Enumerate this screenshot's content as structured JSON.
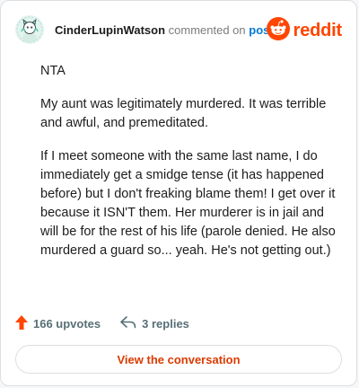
{
  "header": {
    "author": "CinderLupinWatson",
    "meta_text": "commented on",
    "post_link": "post",
    "brand": "reddit"
  },
  "comment": {
    "paragraphs": [
      "NTA",
      "My aunt was legitimately murdered. It was terrible and awful, and premeditated.",
      "If I meet someone with the same last name, I do immediately get a smidge tense (it has happened before) but I don't freaking blame them! I get over it because it ISN'T them. Her murderer is in jail and will be for the rest of his life (parole denied. He also murdered a guard so... yeah. He's not getting out.)"
    ]
  },
  "footer": {
    "upvotes": "166 upvotes",
    "replies": "3 replies",
    "view_button": "View the conversation"
  },
  "colors": {
    "brand_orange": "#ff4500",
    "link_blue": "#0079d3",
    "cta_text": "#d93a00"
  },
  "icons": {
    "upvote": "upvote-arrow-icon",
    "reply": "reply-arrow-icon",
    "brand": "reddit-snoo-icon",
    "avatar": "user-avatar"
  }
}
